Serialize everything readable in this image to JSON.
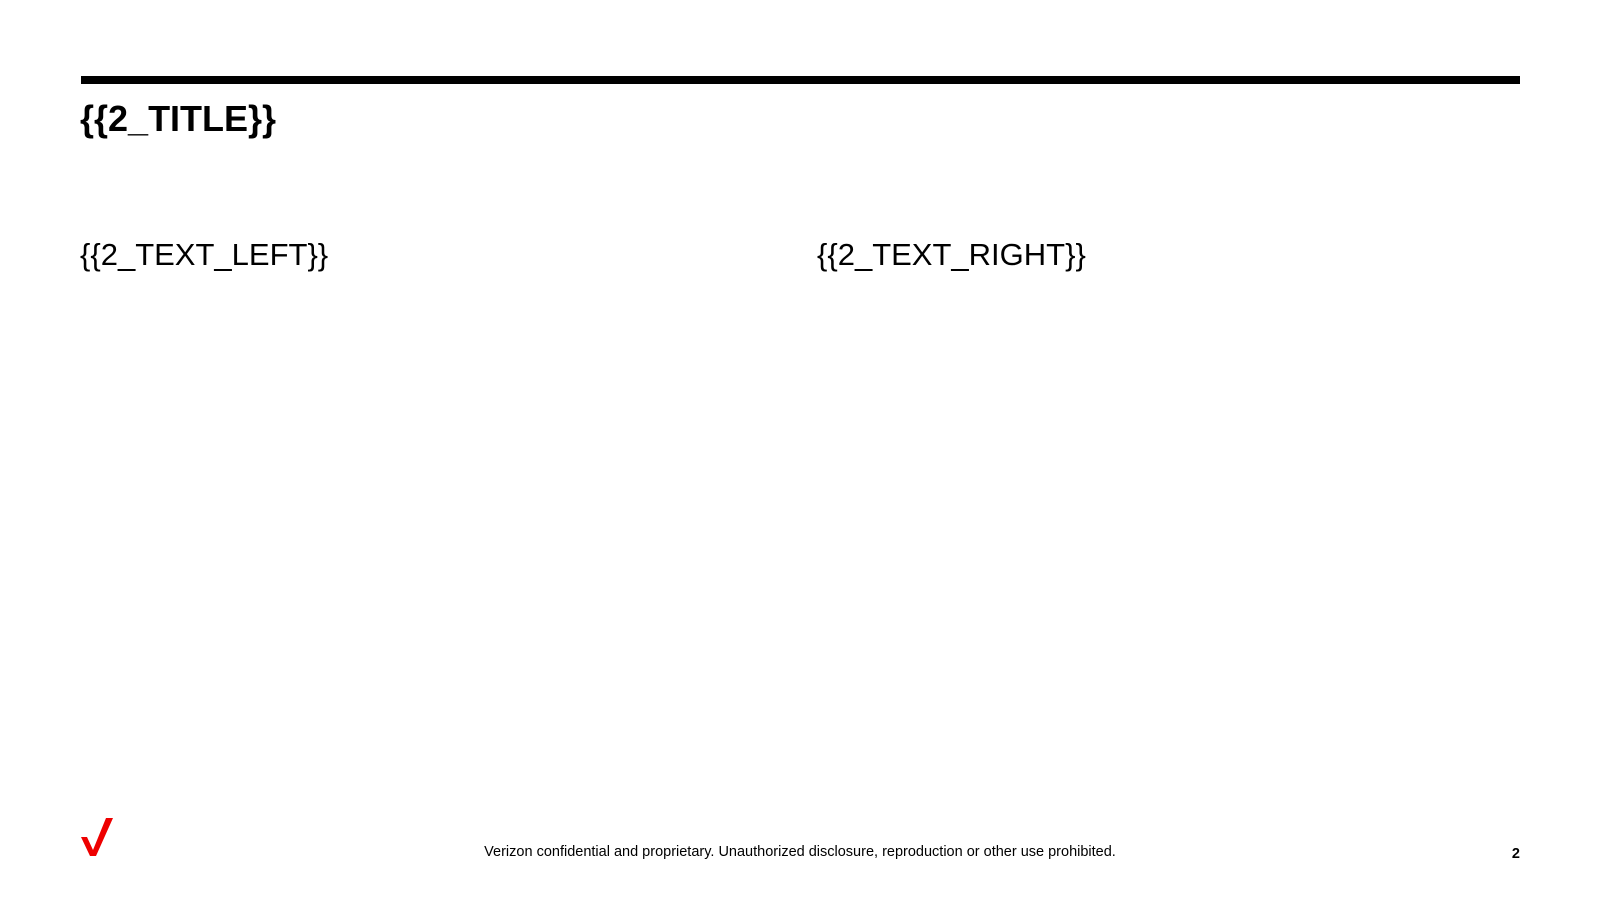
{
  "slide": {
    "title": "{{2_TITLE}}",
    "text_left": "{{2_TEXT_LEFT}}",
    "text_right": "{{2_TEXT_RIGHT}}"
  },
  "footer": {
    "confidential": "Verizon confidential and proprietary. Unauthorized disclosure, reproduction or other use prohibited.",
    "page_number": "2",
    "logo_color": "#EE0000"
  }
}
